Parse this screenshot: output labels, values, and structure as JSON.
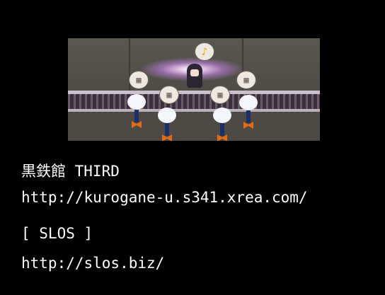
{
  "credits": [
    {
      "title": "黒鉄館 THIRD",
      "url": "http://kurogane-u.s341.xrea.com/"
    },
    {
      "title": "[ SLOS ]",
      "url": "http://slos.biz/"
    }
  ],
  "scene": {
    "speech_icons": [
      "music-note-icon",
      "gift-box-icon",
      "gift-box-icon",
      "gift-box-icon",
      "gift-box-icon"
    ],
    "note_glyph": "♪",
    "box_glyph": "▦"
  }
}
